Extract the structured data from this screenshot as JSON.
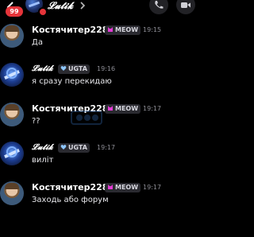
{
  "header": {
    "unread_count": "99",
    "title": "𝓛𝓾𝓽𝓲𝓴",
    "badge_color": "#e5343a"
  },
  "messages": [
    {
      "author": "Костячитер228",
      "tag": "MEOW",
      "tag_icon": "cat-icon",
      "time": "19:15",
      "text": "Да"
    },
    {
      "author": "𝓛𝓾𝓽𝓲𝓴",
      "tag": "UGTA",
      "tag_icon": "heart-icon",
      "time": "19:16",
      "text": "я сразу перекидаю"
    },
    {
      "author": "Костячитер228",
      "tag": "MEOW",
      "tag_icon": "cat-icon",
      "time": "19:17",
      "text": "??"
    },
    {
      "author": "𝓛𝓾𝓽𝓲𝓴",
      "tag": "UGTA",
      "tag_icon": "heart-icon",
      "time": "19:17",
      "text": "виліт"
    },
    {
      "author": "Костячитер228",
      "tag": "MEOW",
      "tag_icon": "cat-icon",
      "time": "19:17",
      "text": "Заходь або форум"
    }
  ]
}
